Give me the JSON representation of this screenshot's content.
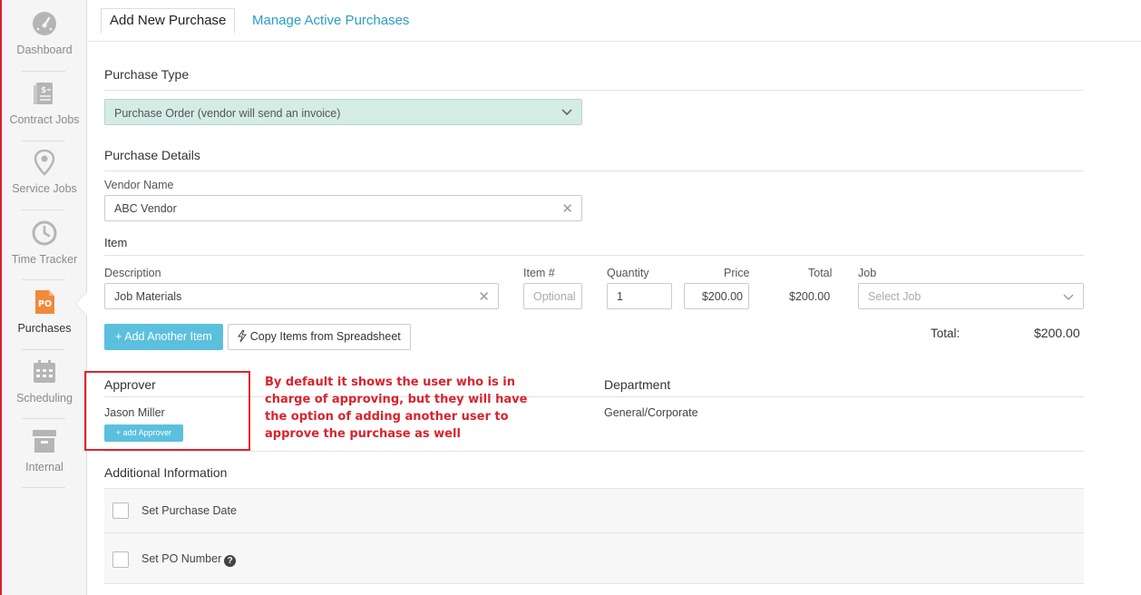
{
  "sidebar": {
    "items": [
      {
        "label": "Dashboard",
        "icon": "dashboard-icon"
      },
      {
        "label": "Contract Jobs",
        "icon": "contract-icon"
      },
      {
        "label": "Service Jobs",
        "icon": "location-pin-icon"
      },
      {
        "label": "Time Tracker",
        "icon": "clock-icon"
      },
      {
        "label": "Purchases",
        "icon": "po-icon",
        "badge": "PO",
        "active": true
      },
      {
        "label": "Scheduling",
        "icon": "calendar-icon"
      },
      {
        "label": "Internal",
        "icon": "archive-box-icon"
      }
    ]
  },
  "tabs": {
    "active": "Add New Purchase",
    "other": "Manage Active Purchases"
  },
  "purchase_type": {
    "title": "Purchase Type",
    "selected": "Purchase Order (vendor will send an invoice)"
  },
  "purchase_details": {
    "title": "Purchase Details",
    "vendor_label": "Vendor Name",
    "vendor_value": "ABC Vendor"
  },
  "item": {
    "title": "Item",
    "headers": {
      "description": "Description",
      "item_no": "Item #",
      "quantity": "Quantity",
      "price": "Price",
      "total": "Total",
      "job": "Job"
    },
    "row": {
      "description": "Job Materials",
      "item_no_placeholder": "Optional",
      "quantity": "1",
      "price": "$200.00",
      "total": "$200.00",
      "job_placeholder": "Select Job"
    },
    "add_button": "+ Add Another Item",
    "copy_button": "Copy Items from Spreadsheet",
    "total_label": "Total:",
    "total_value": "$200.00"
  },
  "approver": {
    "title": "Approver",
    "name": "Jason Miller",
    "add_button": "+ add Approver"
  },
  "department": {
    "title": "Department",
    "value": "General/Corporate"
  },
  "annotation": "By default it shows the user who is in charge of approving, but they will have the option of adding another user to approve the purchase as well",
  "additional": {
    "title": "Additional Information",
    "purchase_date": "Set Purchase Date",
    "po_number": "Set PO Number"
  },
  "colors": {
    "accent": "#5bc0de",
    "link": "#2a9fc6",
    "highlight": "#d9232d",
    "select_bg": "#d4ece6",
    "po_badge": "#f08a3c"
  }
}
